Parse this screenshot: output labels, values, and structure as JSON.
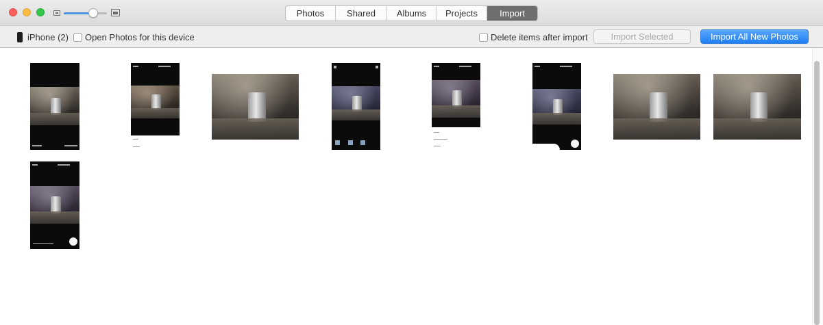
{
  "window": {
    "tabs": [
      {
        "label": "Photos",
        "active": false
      },
      {
        "label": "Shared",
        "active": false
      },
      {
        "label": "Albums",
        "active": false
      },
      {
        "label": "Projects",
        "active": false
      },
      {
        "label": "Import",
        "active": true
      }
    ],
    "zoom_level": 0.7
  },
  "toolbar": {
    "device_label": "iPhone (2)",
    "open_photos_label": "Open Photos for this device",
    "open_photos_checked": false,
    "delete_after_import_label": "Delete items after import",
    "delete_after_import_checked": false,
    "import_selected_label": "Import Selected",
    "import_selected_enabled": false,
    "import_all_label": "Import All New Photos"
  },
  "icons": {
    "close": "close-window-icon",
    "minimize": "minimize-window-icon",
    "maximize": "maximize-window-icon",
    "zoom_small": "small-thumbnail-icon",
    "zoom_large": "large-thumbnail-icon",
    "device": "iphone-icon"
  },
  "photos": [
    {
      "kind": "screenshot"
    },
    {
      "kind": "screenshot"
    },
    {
      "kind": "photo"
    },
    {
      "kind": "screenshot"
    },
    {
      "kind": "screenshot"
    },
    {
      "kind": "screenshot"
    },
    {
      "kind": "photo"
    },
    {
      "kind": "photo"
    },
    {
      "kind": "screenshot"
    }
  ],
  "colors": {
    "accent": "#1f7ef2",
    "active_tab": "#6e6e6e",
    "close": "#fc605c",
    "minimize": "#fdbc40",
    "maximize": "#34c84a"
  }
}
